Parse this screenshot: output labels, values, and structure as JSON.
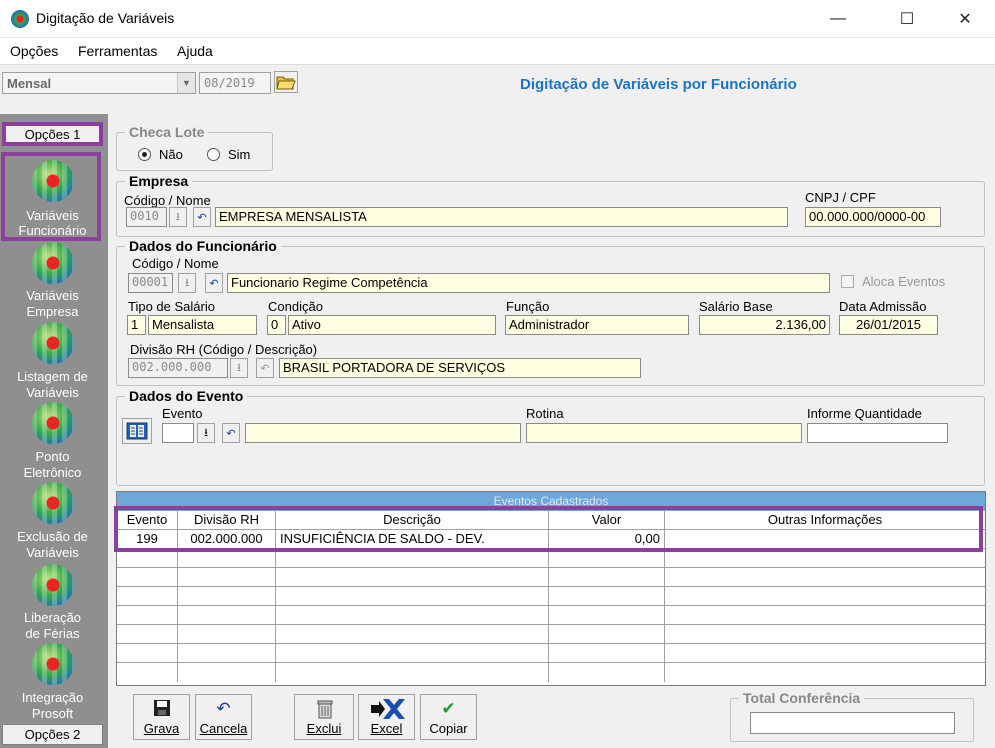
{
  "window": {
    "title": "Digitação de Variáveis",
    "minimize": "—",
    "maximize": "☐",
    "close": "✕"
  },
  "menu": [
    "Opções",
    "Ferramentas",
    "Ajuda"
  ],
  "toolbar": {
    "period": "Mensal",
    "date": "08/2019",
    "header_title": "Digitação de Variáveis por Funcionário"
  },
  "sidebar": {
    "tab_top": "Opções 1",
    "tab_bottom": "Opções 2",
    "items": [
      {
        "label_line1": "Variáveis",
        "label_line2": "Funcionário"
      },
      {
        "label_line1": "Variáveis",
        "label_line2": "Empresa"
      },
      {
        "label_line1": "Listagem de",
        "label_line2": "Variáveis"
      },
      {
        "label_line1": "Ponto",
        "label_line2": "Eletrônico"
      },
      {
        "label_line1": "Exclusão de",
        "label_line2": "Variáveis"
      },
      {
        "label_line1": "Liberação",
        "label_line2": "de Férias"
      },
      {
        "label_line1": "Integração",
        "label_line2": "Prosoft"
      }
    ]
  },
  "checa_lote": {
    "legend": "Checa Lote",
    "opt_no": "Não",
    "opt_yes": "Sim",
    "selected": "Não"
  },
  "empresa": {
    "legend": "Empresa",
    "code_label": "Código / Nome",
    "code": "0010",
    "name": "EMPRESA MENSALISTA",
    "cnpj_label": "CNPJ / CPF",
    "cnpj": "00.000.000/0000-00"
  },
  "funcionario": {
    "legend": "Dados do Funcionário",
    "code_label": "Código / Nome",
    "code": "00001",
    "name": "Funcionario Regime Competência",
    "aloca_label": "Aloca Eventos",
    "tipo_label": "Tipo de Salário",
    "tipo_code": "1",
    "tipo": "Mensalista",
    "cond_label": "Condição",
    "cond_code": "0",
    "cond": "Ativo",
    "funcao_label": "Função",
    "funcao": "Administrador",
    "salario_label": "Salário Base",
    "salario": "2.136,00",
    "admissao_label": "Data Admissão",
    "admissao": "26/01/2015",
    "divisao_label": "Divisão RH (Código / Descrição)",
    "divisao_code": "002.000.000",
    "divisao": "BRASIL PORTADORA DE SERVIÇOS"
  },
  "evento": {
    "legend": "Dados do Evento",
    "evento_label": "Evento",
    "rotina_label": "Rotina",
    "qtd_label": "Informe Quantidade"
  },
  "grid": {
    "caption": "Eventos Cadastrados",
    "headers": [
      "Evento",
      "Divisão RH",
      "Descrição",
      "Valor",
      "Outras Informações"
    ],
    "rows": [
      [
        "199",
        "002.000.000",
        "INSUFICIÊNCIA DE SALDO - DEV.",
        "0,00",
        ""
      ]
    ]
  },
  "buttons": {
    "grava": "Grava",
    "cancela": "Cancela",
    "exclui": "Exclui",
    "excel": "Excel",
    "copiar": "Copiar"
  },
  "total": {
    "legend": "Total Conferência"
  },
  "colors": {
    "accent": "#1a74c9",
    "highlight": "#8c3f9c",
    "field_bg": "#ffffe1",
    "sidebar": "#8f8f8f"
  }
}
